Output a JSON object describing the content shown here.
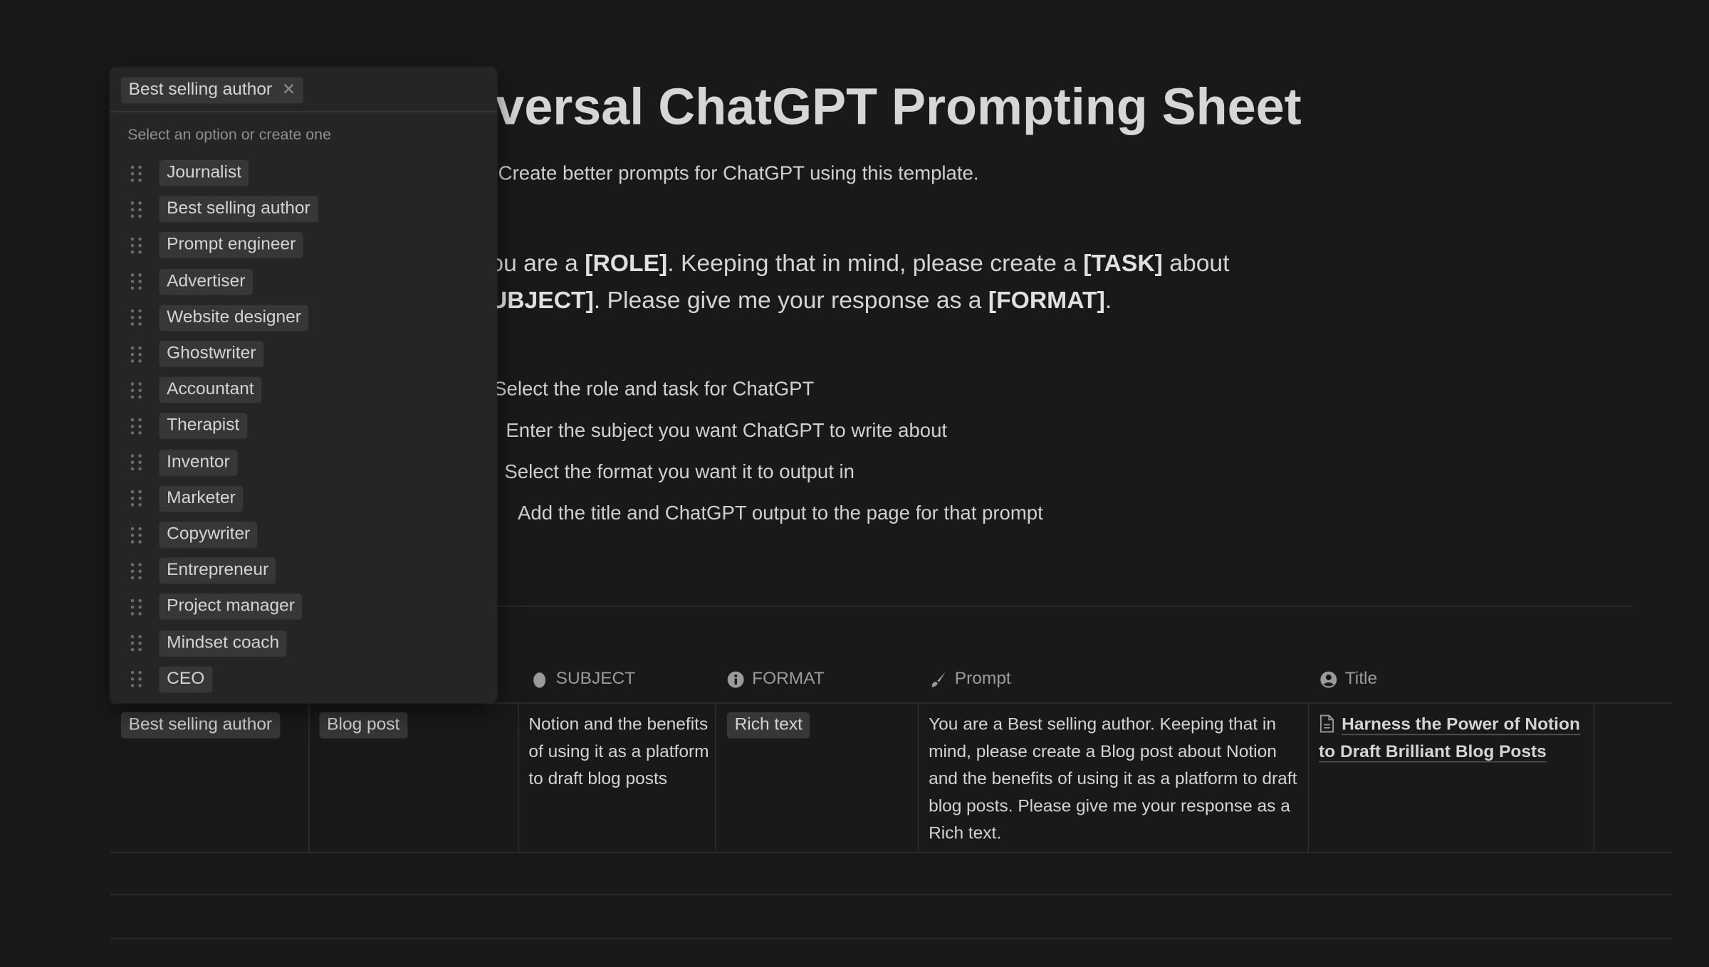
{
  "page": {
    "title": "Universal ChatGPT Prompting Sheet",
    "subtitle": "Create better prompts for ChatGPT using this template.",
    "template_line1": {
      "a": "You are a ",
      "role": "[ROLE]",
      "b": ".  Keeping that in mind, please create a ",
      "task": "[TASK]",
      "c": " about"
    },
    "template_line2": {
      "subject": "[SUBJECT]",
      "b": ". Please give me your response as a ",
      "format": "[FORMAT]",
      "c": "."
    },
    "steps": [
      "Select the role and task for ChatGPT",
      "Enter the subject you want ChatGPT to write about",
      "Select the format you want it to output in",
      "Add the title and ChatGPT output to the page for that prompt"
    ]
  },
  "table": {
    "headers": {
      "subject": "SUBJECT",
      "format": "FORMAT",
      "prompt": "Prompt",
      "title": "Title"
    },
    "icons": {
      "subject": "egg-icon",
      "format": "info-icon",
      "prompt": "paintbrush-icon",
      "title": "user-circle-icon",
      "page": "document-icon"
    },
    "rows": [
      {
        "role": "Best selling author",
        "task": "Blog post",
        "subject": "Notion and the benefits of using it as a platform to draft blog posts",
        "format": "Rich text",
        "prompt": "You are a Best selling author. Keeping that in mind, please create a Blog post about Notion and the benefits of using it as a platform to draft blog posts. Please give me your response as a Rich text.",
        "title": "Harness the Power of Notion to Draft Brilliant Blog Posts"
      }
    ]
  },
  "dropdown": {
    "selected": "Best selling author",
    "hint": "Select an option or create one",
    "options": [
      "Journalist",
      "Best selling author",
      "Prompt engineer",
      "Advertiser",
      "Website designer",
      "Ghostwriter",
      "Accountant",
      "Therapist",
      "Inventor",
      "Marketer",
      "Copywriter",
      "Entrepreneur",
      "Project manager",
      "Mindset coach",
      "CEO"
    ]
  },
  "colors": {
    "background": "#191919",
    "popup": "#252525",
    "tag": "#373737",
    "text": "#d4d4d4"
  }
}
